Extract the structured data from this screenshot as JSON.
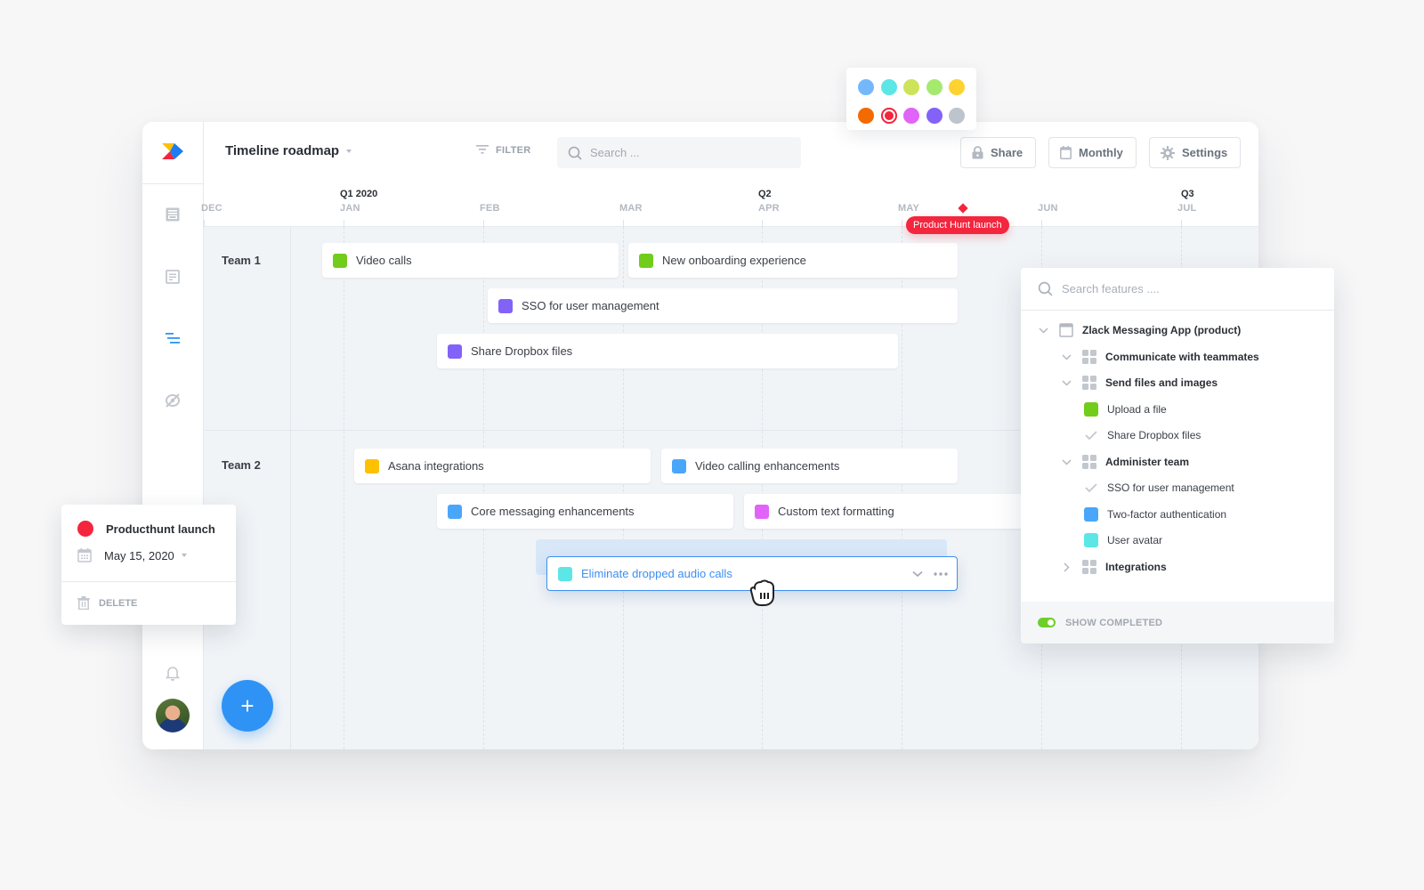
{
  "header": {
    "title": "Timeline roadmap",
    "filter_label": "FILTER",
    "search_placeholder": "Search ...",
    "buttons": {
      "share": "Share",
      "view": "Monthly",
      "settings": "Settings"
    }
  },
  "sidebar": {
    "icons": [
      "notes-icon",
      "document-icon",
      "roadmap-icon",
      "hidden-icon"
    ],
    "active": "roadmap-icon"
  },
  "timeline": {
    "quarters": [
      {
        "label": "Q1 2020",
        "month": "JAN"
      },
      {
        "label": "Q2",
        "month": "APR"
      },
      {
        "label": "Q3",
        "month": "JUL"
      }
    ],
    "months": [
      "DEC",
      "JAN",
      "FEB",
      "MAR",
      "APR",
      "MAY",
      "JUN",
      "JUL"
    ],
    "milestone": {
      "label": "Product Hunt launch",
      "color": "#f3263d"
    }
  },
  "teams": [
    {
      "label": "Team 1",
      "bars": [
        {
          "label": "Video calls",
          "color": "#72cc1c"
        },
        {
          "label": "New onboarding experience",
          "color": "#72cc1c"
        },
        {
          "label": "SSO for user management",
          "color": "#8262f8"
        },
        {
          "label": "Share Dropbox files",
          "color": "#8262f8"
        }
      ]
    },
    {
      "label": "Team 2",
      "bars": [
        {
          "label": "Asana integrations",
          "color": "#fdc100"
        },
        {
          "label": "Video calling enhancements",
          "color": "#4aa6fb"
        },
        {
          "label": "Core messaging enhancements",
          "color": "#4aa6fb"
        },
        {
          "label": "Custom text formatting",
          "color": "#e163f8"
        },
        {
          "label": "Eliminate dropped audio calls",
          "color": "#5ce6e6",
          "active": true
        }
      ]
    }
  ],
  "palette": {
    "colors": [
      "#74b8fb",
      "#5ce6e6",
      "#cde35a",
      "#a6e96f",
      "#fed22f",
      "#f36a00",
      "#f3263d",
      "#e163f8",
      "#8262f8",
      "#bec4cb"
    ],
    "selected": "#f3263d"
  },
  "milestone_popover": {
    "name": "Producthunt launch",
    "date": "May 15, 2020",
    "delete_label": "DELETE",
    "color": "#f3263d"
  },
  "features_panel": {
    "search_placeholder": "Search features ....",
    "tree": [
      {
        "label": "Zlack Messaging App (product)",
        "type": "product",
        "expanded": true,
        "level": 0
      },
      {
        "label": "Communicate with teammates",
        "type": "group",
        "expanded": true,
        "level": 1
      },
      {
        "label": "Send files and images",
        "type": "group",
        "expanded": true,
        "level": 1
      },
      {
        "label": "Upload a file",
        "type": "feature",
        "color": "#72cc1c",
        "level": 2
      },
      {
        "label": "Share Dropbox files",
        "type": "completed",
        "level": 2
      },
      {
        "label": "Administer team",
        "type": "group",
        "expanded": true,
        "level": 1
      },
      {
        "label": "SSO for user management",
        "type": "completed",
        "level": 2
      },
      {
        "label": "Two-factor authentication",
        "type": "feature",
        "color": "#4aa6fb",
        "level": 2
      },
      {
        "label": "User avatar",
        "type": "feature",
        "color": "#5ce6e6",
        "level": 2
      },
      {
        "label": "Integrations",
        "type": "group",
        "expanded": false,
        "level": 1
      }
    ],
    "show_completed_label": "SHOW COMPLETED",
    "show_completed": true
  },
  "fab_label": "+",
  "accent": "#2f93f5"
}
